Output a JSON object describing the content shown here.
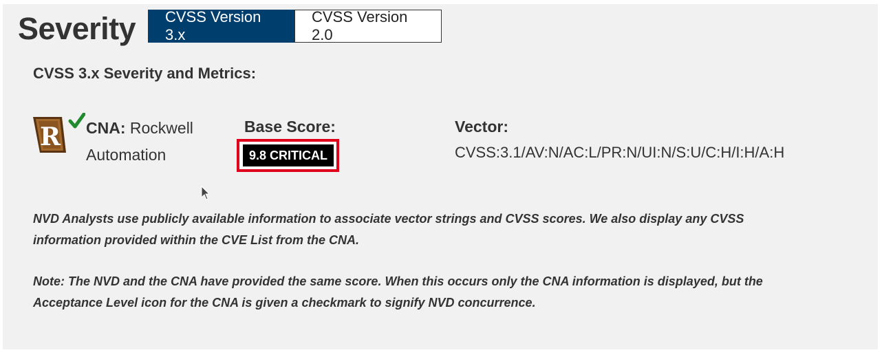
{
  "section": {
    "title": "Severity",
    "tabs": [
      {
        "label": "CVSS Version 3.x",
        "active": true
      },
      {
        "label": "CVSS Version 2.0",
        "active": false
      }
    ],
    "subtitle": "CVSS 3.x Severity and Metrics:"
  },
  "cna": {
    "label": "CNA:",
    "name": "Rockwell Automation",
    "logo_letter": "R",
    "icon": "acceptance-level-icon"
  },
  "base_score": {
    "label": "Base Score:",
    "value": "9.8 CRITICAL"
  },
  "vector": {
    "label": "Vector:",
    "value": "CVSS:3.1/AV:N/AC:L/PR:N/UI:N/S:U/C:H/I:H/A:H"
  },
  "notes": {
    "analysts": "NVD Analysts use publicly available information to associate vector strings and CVSS scores. We also display any CVSS information provided within the CVE List from the CNA.",
    "same_score": "Note: The NVD and the CNA have provided the same score. When this occurs only the CNA information is displayed, but the Acceptance Level icon for the CNA is given a checkmark to signify NVD concurrence."
  },
  "colors": {
    "tab_active": "#003e6e",
    "badge": "#000000",
    "highlight": "#e0001b",
    "checkmark": "#1f8a2e",
    "logo_brown": "#7a4a1f"
  }
}
